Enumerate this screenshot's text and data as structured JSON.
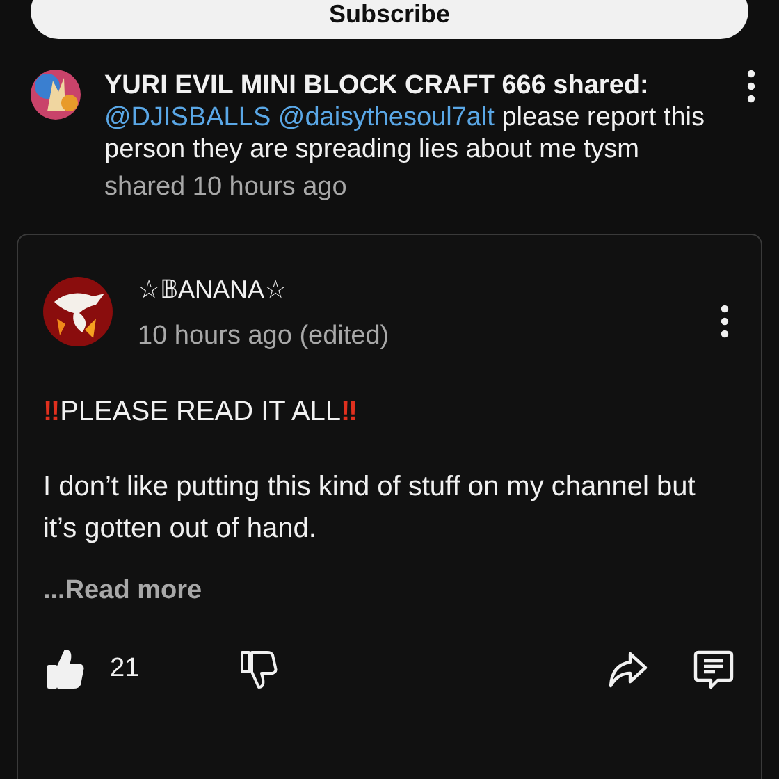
{
  "subscribe_button": {
    "label": "Subscribe"
  },
  "shared_post": {
    "heading": "YURI EVIL MINI BLOCK CRAFT 666 shared:",
    "mentions": [
      "@DJISBALLS",
      "@daisythesoul7alt"
    ],
    "text": "please report this person they are spreading lies about me tysm",
    "time": "shared 10 hours ago"
  },
  "comment": {
    "author": "☆𝔹ANANA☆",
    "time": "10 hours ago (edited)",
    "headline": {
      "mark": "‼",
      "text": "PLEASE READ IT ALL"
    },
    "body": "I don’t like putting this kind of stuff on my channel but it’s gotten out of hand.",
    "read_more": "...Read more",
    "likes": "21",
    "liked": true,
    "disliked": false
  }
}
